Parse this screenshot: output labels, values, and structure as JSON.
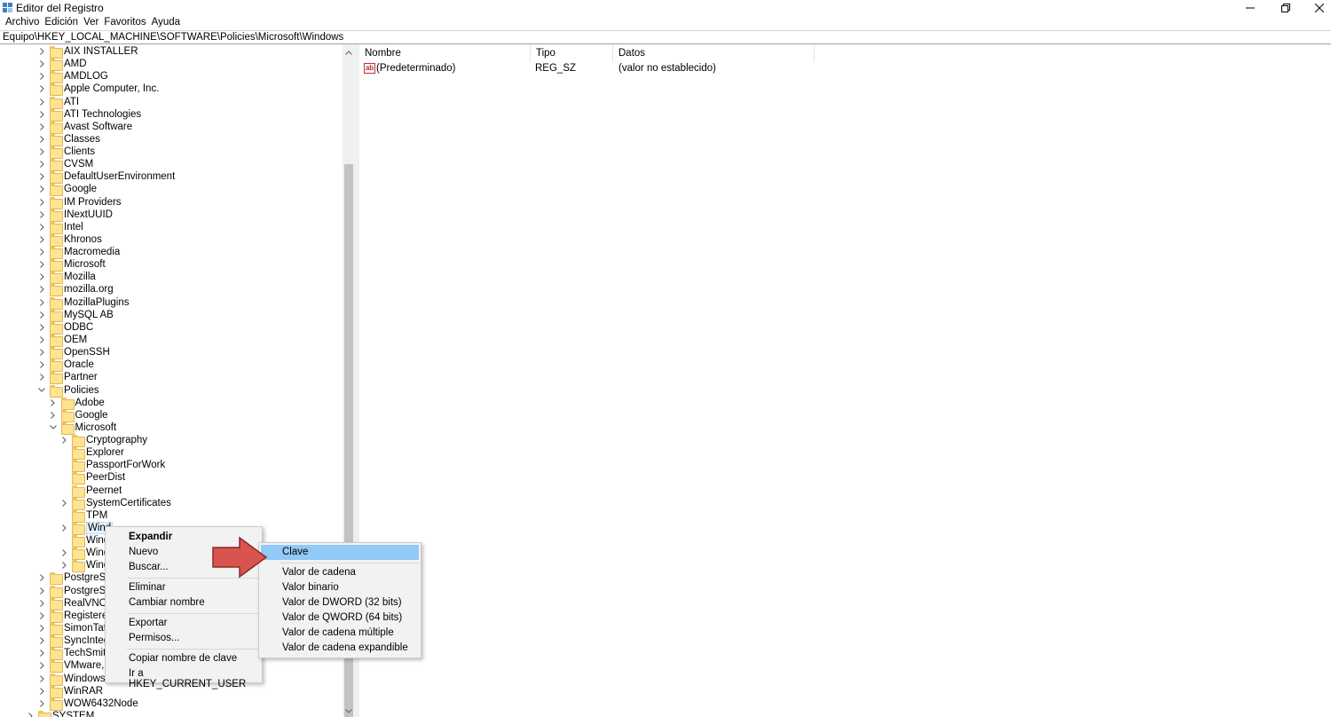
{
  "window": {
    "title": "Editor del Registro",
    "minimize_icon": "minimize-icon",
    "restore_icon": "restore-icon",
    "close_icon": "close-icon"
  },
  "menu": [
    "Archivo",
    "Edición",
    "Ver",
    "Favoritos",
    "Ayuda"
  ],
  "address": "Equipo\\HKEY_LOCAL_MACHINE\\SOFTWARE\\Policies\\Microsoft\\Windows",
  "tree": [
    {
      "label": "AIX INSTALLER",
      "level": 0,
      "chevron": "right"
    },
    {
      "label": "AMD",
      "level": 0,
      "chevron": "right"
    },
    {
      "label": "AMDLOG",
      "level": 0,
      "chevron": "right"
    },
    {
      "label": "Apple Computer, Inc.",
      "level": 0,
      "chevron": "right"
    },
    {
      "label": "ATI",
      "level": 0,
      "chevron": "right"
    },
    {
      "label": "ATI Technologies",
      "level": 0,
      "chevron": "right"
    },
    {
      "label": "Avast Software",
      "level": 0,
      "chevron": "right"
    },
    {
      "label": "Classes",
      "level": 0,
      "chevron": "right"
    },
    {
      "label": "Clients",
      "level": 0,
      "chevron": "right"
    },
    {
      "label": "CVSM",
      "level": 0,
      "chevron": "right"
    },
    {
      "label": "DefaultUserEnvironment",
      "level": 0,
      "chevron": "right"
    },
    {
      "label": "Google",
      "level": 0,
      "chevron": "right"
    },
    {
      "label": "IM Providers",
      "level": 0,
      "chevron": "right"
    },
    {
      "label": "INextUUID",
      "level": 0,
      "chevron": "right"
    },
    {
      "label": "Intel",
      "level": 0,
      "chevron": "right"
    },
    {
      "label": "Khronos",
      "level": 0,
      "chevron": "right"
    },
    {
      "label": "Macromedia",
      "level": 0,
      "chevron": "right"
    },
    {
      "label": "Microsoft",
      "level": 0,
      "chevron": "right"
    },
    {
      "label": "Mozilla",
      "level": 0,
      "chevron": "right"
    },
    {
      "label": "mozilla.org",
      "level": 0,
      "chevron": "right"
    },
    {
      "label": "MozillaPlugins",
      "level": 0,
      "chevron": "right"
    },
    {
      "label": "MySQL AB",
      "level": 0,
      "chevron": "right"
    },
    {
      "label": "ODBC",
      "level": 0,
      "chevron": "right"
    },
    {
      "label": "OEM",
      "level": 0,
      "chevron": "right"
    },
    {
      "label": "OpenSSH",
      "level": 0,
      "chevron": "right"
    },
    {
      "label": "Oracle",
      "level": 0,
      "chevron": "right"
    },
    {
      "label": "Partner",
      "level": 0,
      "chevron": "right"
    },
    {
      "label": "Policies",
      "level": 0,
      "chevron": "down"
    },
    {
      "label": "Adobe",
      "level": 1,
      "chevron": "right"
    },
    {
      "label": "Google",
      "level": 1,
      "chevron": "right"
    },
    {
      "label": "Microsoft",
      "level": 1,
      "chevron": "down"
    },
    {
      "label": "Cryptography",
      "level": 2,
      "chevron": "right"
    },
    {
      "label": "Explorer",
      "level": 2,
      "chevron": "none"
    },
    {
      "label": "PassportForWork",
      "level": 2,
      "chevron": "none"
    },
    {
      "label": "PeerDist",
      "level": 2,
      "chevron": "none"
    },
    {
      "label": "Peernet",
      "level": 2,
      "chevron": "none"
    },
    {
      "label": "SystemCertificates",
      "level": 2,
      "chevron": "right"
    },
    {
      "label": "TPM",
      "level": 2,
      "chevron": "none"
    },
    {
      "label": "Wind",
      "level": 2,
      "chevron": "right",
      "selected": true
    },
    {
      "label": "Wind",
      "level": 2,
      "chevron": "none"
    },
    {
      "label": "Wind",
      "level": 2,
      "chevron": "right"
    },
    {
      "label": "Wind",
      "level": 2,
      "chevron": "right"
    },
    {
      "label": "PostgreSQL",
      "level": 0,
      "chevron": "right"
    },
    {
      "label": "PostgreSQL",
      "level": 0,
      "chevron": "right"
    },
    {
      "label": "RealVNC",
      "level": 0,
      "chevron": "right"
    },
    {
      "label": "RegisteredA",
      "level": 0,
      "chevron": "right"
    },
    {
      "label": "SimonTatha",
      "level": 0,
      "chevron": "right"
    },
    {
      "label": "SyncIntegra",
      "level": 0,
      "chevron": "right"
    },
    {
      "label": "TechSmith",
      "level": 0,
      "chevron": "right"
    },
    {
      "label": "VMware, In",
      "level": 0,
      "chevron": "right"
    },
    {
      "label": "Windows",
      "level": 0,
      "chevron": "right"
    },
    {
      "label": "WinRAR",
      "level": 0,
      "chevron": "right"
    },
    {
      "label": "WOW6432Node",
      "level": 0,
      "chevron": "right"
    },
    {
      "label": "SYSTEM",
      "level": -1,
      "chevron": "right"
    }
  ],
  "list": {
    "columns": [
      "Nombre",
      "Tipo",
      "Datos"
    ],
    "rows": [
      {
        "name": "(Predeterminado)",
        "type": "REG_SZ",
        "data": "(valor no establecido)",
        "icon": "string-value-icon"
      }
    ]
  },
  "context_menu": {
    "items": [
      {
        "label": "Expandir",
        "bold": true
      },
      {
        "label": "Nuevo",
        "submenu": true,
        "highlighted": false
      },
      {
        "label": "Buscar..."
      },
      {
        "label": "Eliminar"
      },
      {
        "label": "Cambiar nombre"
      },
      {
        "label": "Exportar"
      },
      {
        "label": "Permisos..."
      },
      {
        "label": "Copiar nombre de clave"
      },
      {
        "label": "Ir a HKEY_CURRENT_USER"
      }
    ]
  },
  "submenu": {
    "items": [
      {
        "label": "Clave",
        "highlighted": true
      },
      {
        "label": "Valor de cadena"
      },
      {
        "label": "Valor binario"
      },
      {
        "label": "Valor de DWORD (32 bits)"
      },
      {
        "label": "Valor de QWORD (64 bits)"
      },
      {
        "label": "Valor de cadena múltiple"
      },
      {
        "label": "Valor de cadena expandible"
      }
    ]
  },
  "colors": {
    "highlight": "#91c9f7",
    "arrow": "#d9534f",
    "folder": "#fde392"
  }
}
